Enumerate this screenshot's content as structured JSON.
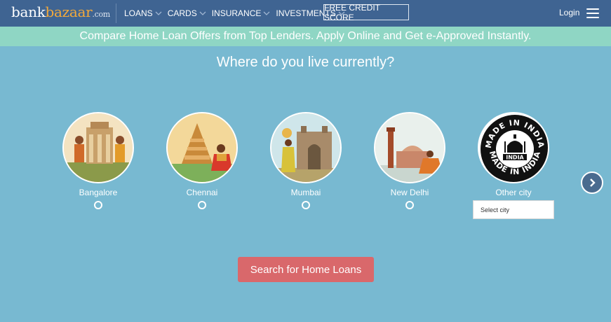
{
  "header": {
    "logo": {
      "part1": "bank",
      "part2": "bazaar",
      "part3": ".com"
    },
    "nav": [
      {
        "label": "LOANS"
      },
      {
        "label": "CARDS"
      },
      {
        "label": "INSURANCE"
      },
      {
        "label": "INVESTMENTS"
      }
    ],
    "credit_score_label": "FREE CREDIT SCORE",
    "login_label": "Login",
    "menu_icon": "hamburger-icon"
  },
  "banner": {
    "text": "Compare Home Loan Offers from Top Lenders. Apply Online and Get e-Approved Instantly."
  },
  "question": "Where do you live currently?",
  "cities": [
    {
      "name": "Bangalore",
      "icon": "bangalore-illustration"
    },
    {
      "name": "Chennai",
      "icon": "chennai-illustration"
    },
    {
      "name": "Mumbai",
      "icon": "mumbai-illustration"
    },
    {
      "name": "New Delhi",
      "icon": "new-delhi-illustration"
    },
    {
      "name": "Other city",
      "icon": "made-in-india-seal",
      "seal_text_top": "MADE IN INDIA",
      "seal_text_center": "INDIA",
      "seal_text_bottom": "MADE IN INDIA"
    }
  ],
  "other_city_select": {
    "placeholder": "Select city"
  },
  "next_icon": "chevron-right-icon",
  "search_button": "Search for Home Loans",
  "colors": {
    "header_bg": "#3f6492",
    "banner_bg": "#8fd6c4",
    "page_bg": "#78b9d1",
    "accent": "#f2a93b",
    "search_button_bg": "#d9686b"
  }
}
